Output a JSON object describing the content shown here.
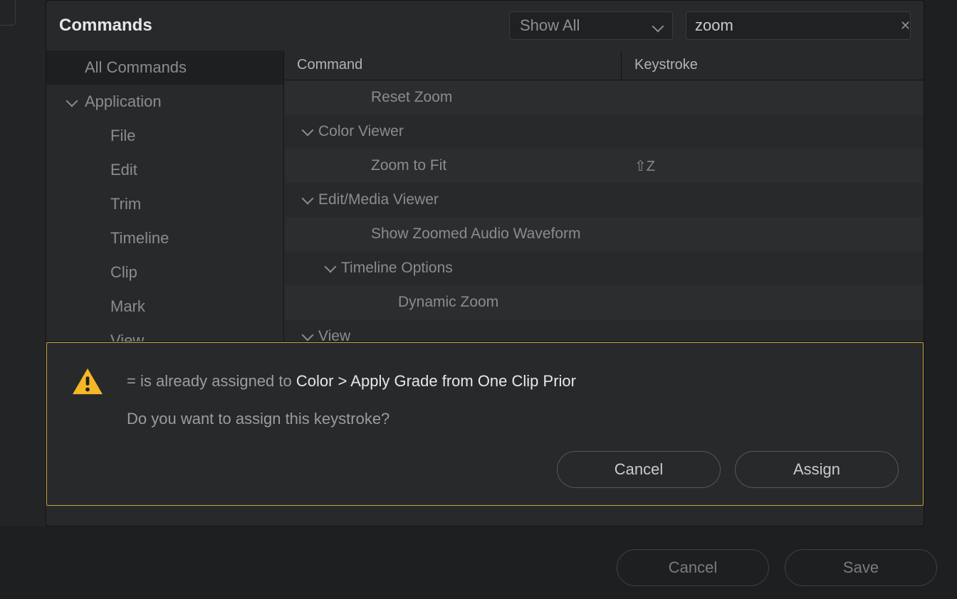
{
  "header": {
    "title": "Commands",
    "filter_label": "Show All",
    "search_value": "zoom"
  },
  "sidebar": {
    "items": [
      {
        "label": "All Commands",
        "selected": true,
        "expandable": false
      },
      {
        "label": "Application",
        "selected": false,
        "expandable": true
      },
      {
        "label": "File",
        "child": true
      },
      {
        "label": "Edit",
        "child": true
      },
      {
        "label": "Trim",
        "child": true
      },
      {
        "label": "Timeline",
        "child": true
      },
      {
        "label": "Clip",
        "child": true
      },
      {
        "label": "Mark",
        "child": true
      },
      {
        "label": "View",
        "child": true
      }
    ]
  },
  "table": {
    "header_command": "Command",
    "header_keystroke": "Keystroke",
    "rows": [
      {
        "label": "Reset Zoom",
        "indent": 2,
        "expandable": false,
        "key": ""
      },
      {
        "label": "Color Viewer",
        "indent": 0,
        "expandable": true,
        "key": ""
      },
      {
        "label": "Zoom to Fit",
        "indent": 2,
        "expandable": false,
        "key": "⇧Z"
      },
      {
        "label": "Edit/Media Viewer",
        "indent": 0,
        "expandable": true,
        "key": ""
      },
      {
        "label": "Show Zoomed Audio Waveform",
        "indent": 2,
        "expandable": false,
        "key": ""
      },
      {
        "label": "Timeline Options",
        "indent": 1,
        "expandable": true,
        "key": ""
      },
      {
        "label": "Dynamic Zoom",
        "indent": 3,
        "expandable": false,
        "key": ""
      },
      {
        "label": "View",
        "indent": 0,
        "expandable": true,
        "key": ""
      }
    ]
  },
  "alert": {
    "prefix": "= is already assigned to ",
    "strong": "Color > Apply Grade from One Clip Prior",
    "question": "Do you want to assign this keystroke?",
    "cancel": "Cancel",
    "assign": "Assign"
  },
  "footer": {
    "cancel": "Cancel",
    "save": "Save"
  }
}
